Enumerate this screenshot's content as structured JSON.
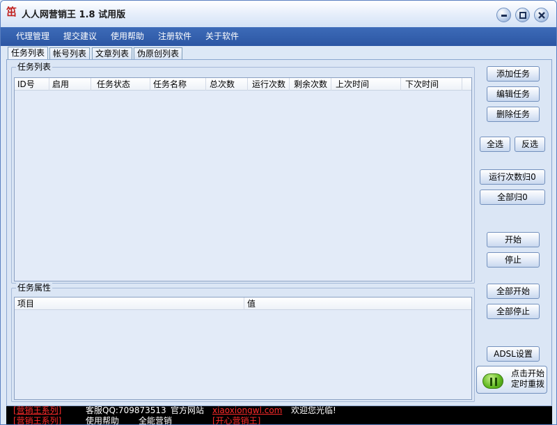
{
  "window": {
    "title": "人人网营销王 1.8 试用版",
    "icon": "app-logo-icon"
  },
  "controls": {
    "minimize": "minimize-icon",
    "maximize": "maximize-icon",
    "close": "close-icon"
  },
  "menu": [
    "代理管理",
    "提交建议",
    "使用帮助",
    "注册软件",
    "关于软件"
  ],
  "tabs": [
    "任务列表",
    "帐号列表",
    "文章列表",
    "伪原创列表"
  ],
  "task_list": {
    "title": "任务列表",
    "columns": [
      "ID号",
      "启用",
      "任务状态",
      "任务名称",
      "总次数",
      "运行次数",
      "剩余次数",
      "上次时间",
      "下次时间"
    ]
  },
  "task_props": {
    "title": "任务属性",
    "columns": [
      "项目",
      "值"
    ]
  },
  "buttons": {
    "add": "添加任务",
    "edit": "编辑任务",
    "delete": "删除任务",
    "select_all": "全选",
    "invert": "反选",
    "reset_runs": "运行次数归0",
    "reset_all": "全部归0",
    "start": "开始",
    "stop": "停止",
    "start_all": "全部开始",
    "stop_all": "全部停止",
    "adsl": "ADSL设置",
    "redial_line1": "点击开始",
    "redial_line2": "定时重拨"
  },
  "status": {
    "line1_a": "[营销王系列]",
    "line1_b": "客服QQ:709873513",
    "line1_c": "官方网站",
    "line1_d": "xiaoxiongwl.com",
    "line1_e": "欢迎您光临!",
    "line2_a": "[营销王系列]",
    "line2_b": "使用帮助",
    "line2_c": "全能营销",
    "line2_d": "[开心营销王]",
    "colors": {
      "red": "#ff2a2a",
      "white": "#ffffff"
    }
  }
}
